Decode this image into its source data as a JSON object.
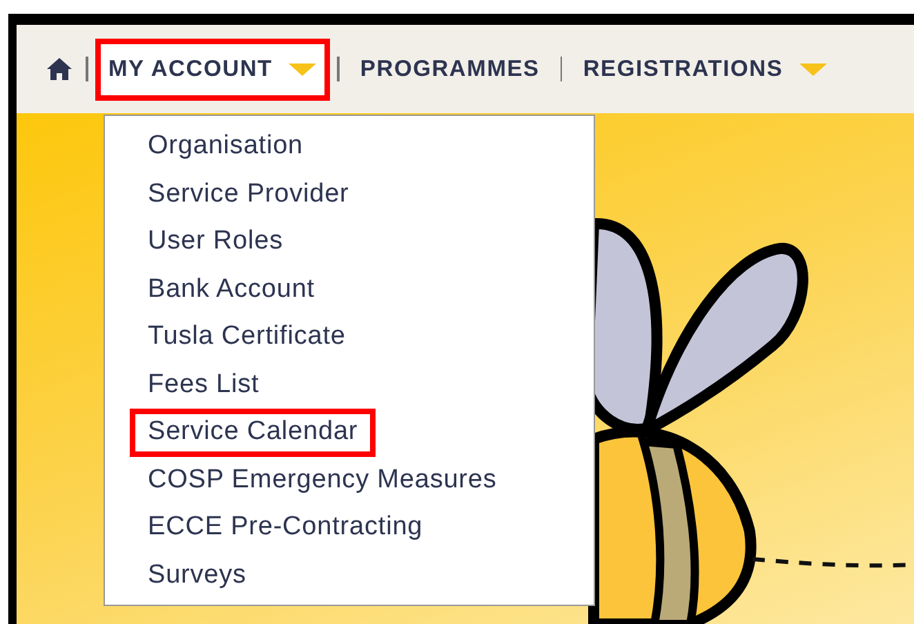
{
  "nav": {
    "items": [
      {
        "kind": "home"
      },
      {
        "kind": "link",
        "label": "MY ACCOUNT",
        "dropdown": true,
        "highlighted": true
      },
      {
        "kind": "link",
        "label": "PROGRAMMES",
        "dropdown": false,
        "highlighted": false
      },
      {
        "kind": "link",
        "label": "REGISTRATIONS",
        "dropdown": true,
        "highlighted": false
      }
    ]
  },
  "dropdown": {
    "items": [
      {
        "label": "Organisation",
        "highlighted": false
      },
      {
        "label": "Service Provider",
        "highlighted": false
      },
      {
        "label": "User Roles",
        "highlighted": false
      },
      {
        "label": "Bank Account",
        "highlighted": false
      },
      {
        "label": "Tusla Certificate",
        "highlighted": false
      },
      {
        "label": "Fees List",
        "highlighted": false
      },
      {
        "label": "Service Calendar",
        "highlighted": true
      },
      {
        "label": "COSP Emergency Measures",
        "highlighted": false
      },
      {
        "label": "ECCE Pre-Contracting",
        "highlighted": false
      },
      {
        "label": "Surveys",
        "highlighted": false
      }
    ]
  }
}
